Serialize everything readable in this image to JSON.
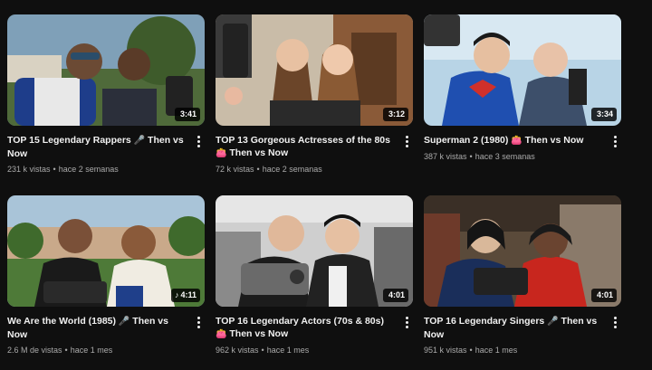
{
  "videos": [
    {
      "title_pre": "TOP 15 Legendary Rappers ",
      "emoji": "🎤",
      "title_post": " Then vs Now",
      "duration": "3:41",
      "views": "231 k vistas",
      "age": "hace 2 semanas",
      "music_note": ""
    },
    {
      "title_pre": "TOP 13 Gorgeous Actresses of the 80s ",
      "emoji": "👛",
      "title_post": " Then vs Now",
      "duration": "3:12",
      "views": "72 k vistas",
      "age": "hace 2 semanas",
      "music_note": ""
    },
    {
      "title_pre": "Superman 2 (1980) ",
      "emoji": "👛",
      "title_post": " Then vs Now",
      "duration": "3:34",
      "views": "387 k vistas",
      "age": "hace 3 semanas",
      "music_note": ""
    },
    {
      "title_pre": "We Are the World (1985) ",
      "emoji": "🎤",
      "title_post": " Then vs Now",
      "duration": "4:11",
      "views": "2.6 M de vistas",
      "age": "hace 1 mes",
      "music_note": "♪"
    },
    {
      "title_pre": "TOP 16 Legendary Actors (70s & 80s) ",
      "emoji": "👛",
      "title_post": " Then vs Now",
      "duration": "4:01",
      "views": "962 k vistas",
      "age": "hace 1 mes",
      "music_note": ""
    },
    {
      "title_pre": "TOP 16 Legendary Singers ",
      "emoji": "🎤",
      "title_post": " Then vs Now",
      "duration": "4:01",
      "views": "951 k vistas",
      "age": "hace 1 mes",
      "music_note": ""
    }
  ],
  "separator": "•",
  "icons": {
    "more": "kebab-menu-icon",
    "music": "music-note-icon"
  }
}
